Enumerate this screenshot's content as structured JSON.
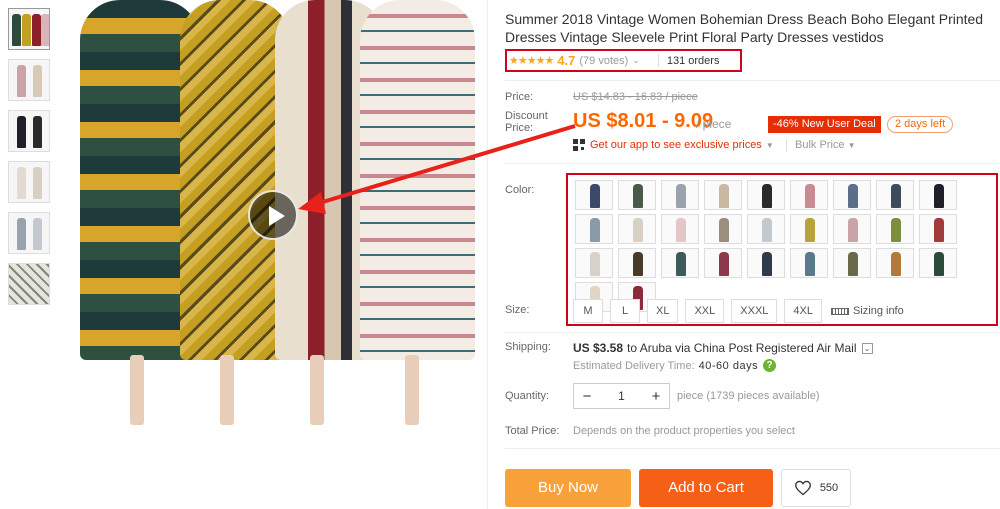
{
  "product": {
    "title": "Summer 2018 Vintage Women Bohemian Dress Beach Boho Elegant Printed Dresses Vintage Sleevele Print Floral Party Dresses vestidos",
    "rating": "4.7",
    "stars": "★★★★★",
    "votes": "(79 votes)",
    "orders": "131 orders"
  },
  "price": {
    "label": "Price:",
    "original": "US $14.83 - 16.83 / piece",
    "discount_label": "Discount Price:",
    "current": "US $8.01 - 9.09",
    "unit": "/ piece",
    "deal": "-46% New User Deal",
    "countdown": "2 days left",
    "app_promo": "Get our app to see exclusive prices",
    "bulk": "Bulk Price"
  },
  "sku": {
    "color_label": "Color:",
    "size_label": "Size:",
    "sizes": [
      "M",
      "L",
      "XL",
      "XXL",
      "XXXL",
      "4XL"
    ],
    "sizing_info": "Sizing info",
    "swatch_colors": [
      "#3b4a6b",
      "#4a5a4a",
      "#9aa3ad",
      "#c9b9a3",
      "#2a2a2a",
      "#c98b91",
      "#5b6e8a",
      "#3f4a5c",
      "#1f1f2a",
      "#8a9aa8",
      "#d9d0c4",
      "#e2c7c9",
      "#9a8f7f",
      "#c3c9cf",
      "#b7a33a",
      "#c9a3a8",
      "#7d8f3a",
      "#a33a3a",
      "#d7d2c9",
      "#4a3a2a",
      "#3e5a5a",
      "#8a3a4a",
      "#2f3a4a",
      "#5a7a8a",
      "#6a6a4a",
      "#b27a3a",
      "#2a4a3a",
      "#e0d4c4",
      "#8a2a3a"
    ]
  },
  "shipping": {
    "label": "Shipping:",
    "cost": "US $3.58",
    "route": "to Aruba via China Post Registered Air Mail",
    "est_label": "Estimated Delivery Time:",
    "est_days": "40-60 days"
  },
  "quantity": {
    "label": "Quantity:",
    "value": "1",
    "minus": "−",
    "plus": "+",
    "available": "piece (1739 pieces available)"
  },
  "total": {
    "label": "Total Price:",
    "hint": "Depends on the product properties you select"
  },
  "actions": {
    "buy_now": "Buy Now",
    "add_to_cart": "Add to Cart",
    "wishlist_count": "550"
  },
  "icons": {
    "play": "play-icon",
    "qr": "qr-code-icon",
    "heart": "heart-icon",
    "help": "help-icon",
    "ruler": "ruler-icon"
  },
  "colors": {
    "accent": "#ff6600",
    "deal_red": "#e62e04",
    "annotation_red": "#d0021b",
    "buy_now": "#f8a13a",
    "add_to_cart": "#f55f16"
  }
}
